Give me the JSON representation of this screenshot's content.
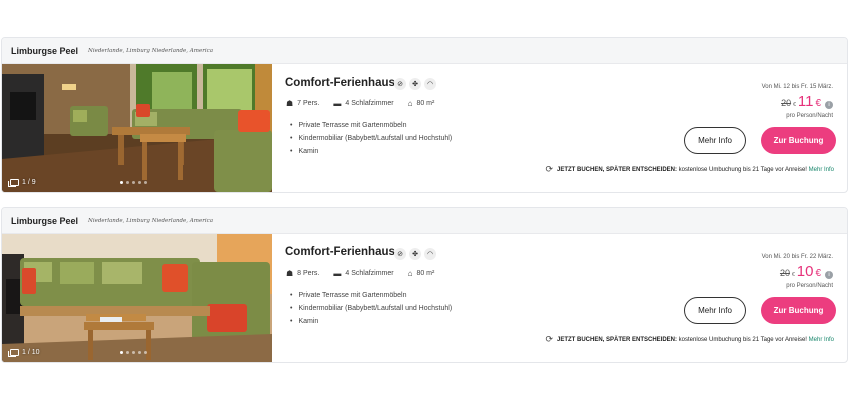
{
  "listings": [
    {
      "park": "Limburgse Peel",
      "region": "Niederlande, Limburg Niederlande, America",
      "photo_counter": "1 / 9",
      "title": "Comfort-Ferienhaus",
      "amenity_icons": [
        "no-pets-icon",
        "pets-icon",
        "wifi-icon"
      ],
      "persons": "7 Pers.",
      "bedrooms": "4 Schlafzimmer",
      "area": "80 m²",
      "features": [
        "Private Terrasse mit Gartenmöbeln",
        "Kindermobiliar (Babybett/Laufstall und Hochstuhl)",
        "Kamin"
      ],
      "dates": "Von Mi. 12 bis Fr. 15 März.",
      "old_price": "20",
      "old_currency": "€",
      "new_price": "11",
      "new_currency": "€",
      "per_night": "pro Person/Nacht",
      "more_info_label": "Mehr Info",
      "book_label": "Zur Buchung",
      "notice_bold": "JETZT BUCHEN, SPÄTER ENTSCHEIDEN:",
      "notice_text": " kostenlose Umbuchung bis 21 Tage vor Anreise!",
      "notice_link": "Mehr Info"
    },
    {
      "park": "Limburgse Peel",
      "region": "Niederlande, Limburg Niederlande, America",
      "photo_counter": "1 / 10",
      "title": "Comfort-Ferienhaus",
      "amenity_icons": [
        "no-pets-icon",
        "pets-icon",
        "wifi-icon"
      ],
      "persons": "8 Pers.",
      "bedrooms": "4 Schlafzimmer",
      "area": "80 m²",
      "features": [
        "Private Terrasse mit Gartenmöbeln",
        "Kindermobiliar (Babybett/Laufstall und Hochstuhl)",
        "Kamin"
      ],
      "dates": "Von Mi. 20 bis Fr. 22 März.",
      "old_price": "20",
      "old_currency": "€",
      "new_price": "10",
      "new_currency": "€",
      "per_night": "pro Person/Nacht",
      "more_info_label": "Mehr Info",
      "book_label": "Zur Buchung",
      "notice_bold": "JETZT BUCHEN, SPÄTER ENTSCHEIDEN:",
      "notice_text": " kostenlose Umbuchung bis 21 Tage vor Anreise!",
      "notice_link": "Mehr Info"
    }
  ],
  "colors": {
    "accent": "#ec3d7f",
    "price": "#e6317a",
    "link": "#17866b"
  }
}
